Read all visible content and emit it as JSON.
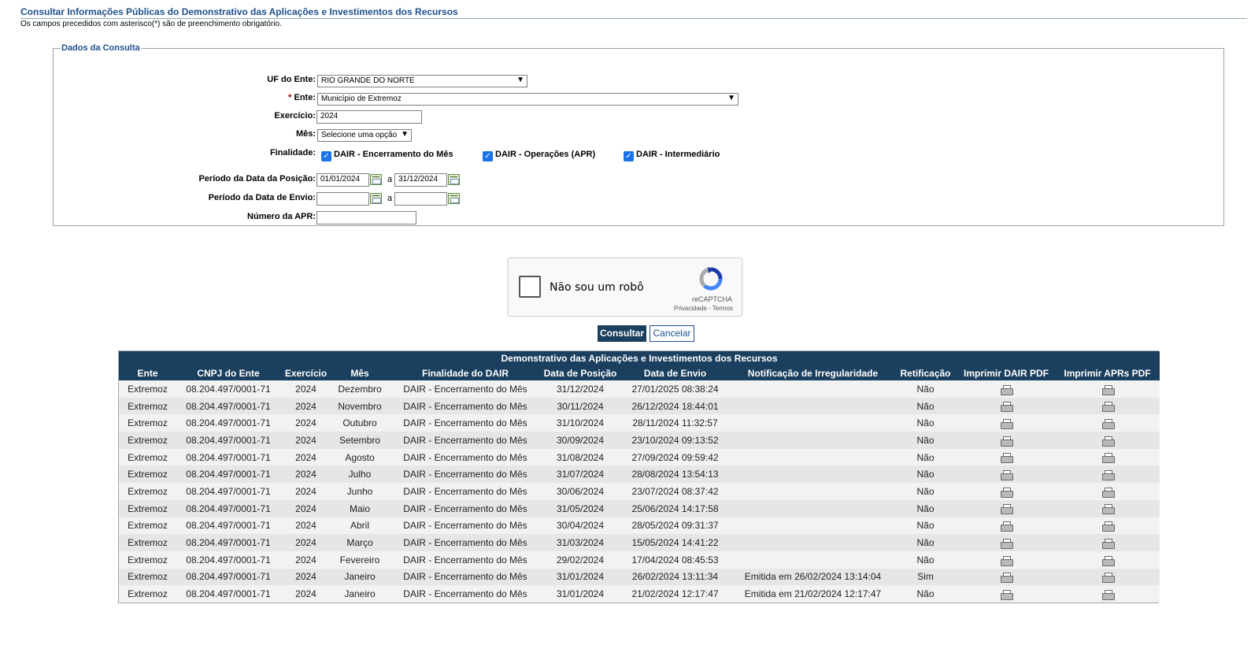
{
  "header": {
    "title": "Consultar Informações Públicas do Demonstrativo das Aplicações e Investimentos dos Recursos",
    "subtitle": "Os campos precedidos com asterisco(*) são de preenchimento obrigatório."
  },
  "form": {
    "legend": "Dados da Consulta",
    "uf_label": "UF do Ente:",
    "uf_value": "RIO GRANDE DO NORTE",
    "ente_required_mark": "*",
    "ente_label": "Ente:",
    "ente_value": "Município de Extremoz",
    "exercicio_label": "Exercício:",
    "exercicio_value": "2024",
    "mes_label": "Mês:",
    "mes_value": "Selecione uma opção",
    "finalidade_label": "Finalidade:",
    "finalidade_options": [
      {
        "label": "DAIR - Encerramento do Mês",
        "checked": true
      },
      {
        "label": "DAIR - Operações (APR)",
        "checked": true
      },
      {
        "label": "DAIR - Intermediário",
        "checked": true
      }
    ],
    "periodo_posicao_label": "Período da Data da Posição:",
    "posicao_inicio": "01/01/2024",
    "posicao_fim": "31/12/2024",
    "periodo_envio_label": "Período da Data de Envio:",
    "envio_inicio": "",
    "envio_fim": "",
    "range_sep": "a",
    "apr_label": "Número da APR:",
    "apr_value": ""
  },
  "captcha": {
    "label": "Não sou um robô",
    "brand": "reCAPTCHA",
    "links": "Privacidade - Termos"
  },
  "buttons": {
    "consultar": "Consultar",
    "cancelar": "Cancelar"
  },
  "table": {
    "caption": "Demonstrativo das Aplicações e Investimentos dos Recursos",
    "headers": [
      "Ente",
      "CNPJ do Ente",
      "Exercício",
      "Mês",
      "Finalidade do DAIR",
      "Data de Posição",
      "Data de Envio",
      "Notificação de Irregularidade",
      "Retificação",
      "Imprimir DAIR PDF",
      "Imprimir APRs PDF"
    ],
    "rows": [
      [
        "Extremoz",
        "08.204.497/0001-71",
        "2024",
        "Dezembro",
        "DAIR - Encerramento do Mês",
        "31/12/2024",
        "27/01/2025 08:38:24",
        "",
        "Não"
      ],
      [
        "Extremoz",
        "08.204.497/0001-71",
        "2024",
        "Novembro",
        "DAIR - Encerramento do Mês",
        "30/11/2024",
        "26/12/2024 18:44:01",
        "",
        "Não"
      ],
      [
        "Extremoz",
        "08.204.497/0001-71",
        "2024",
        "Outubro",
        "DAIR - Encerramento do Mês",
        "31/10/2024",
        "28/11/2024 11:32:57",
        "",
        "Não"
      ],
      [
        "Extremoz",
        "08.204.497/0001-71",
        "2024",
        "Setembro",
        "DAIR - Encerramento do Mês",
        "30/09/2024",
        "23/10/2024 09:13:52",
        "",
        "Não"
      ],
      [
        "Extremoz",
        "08.204.497/0001-71",
        "2024",
        "Agosto",
        "DAIR - Encerramento do Mês",
        "31/08/2024",
        "27/09/2024 09:59:42",
        "",
        "Não"
      ],
      [
        "Extremoz",
        "08.204.497/0001-71",
        "2024",
        "Julho",
        "DAIR - Encerramento do Mês",
        "31/07/2024",
        "28/08/2024 13:54:13",
        "",
        "Não"
      ],
      [
        "Extremoz",
        "08.204.497/0001-71",
        "2024",
        "Junho",
        "DAIR - Encerramento do Mês",
        "30/06/2024",
        "23/07/2024 08:37:42",
        "",
        "Não"
      ],
      [
        "Extremoz",
        "08.204.497/0001-71",
        "2024",
        "Maio",
        "DAIR - Encerramento do Mês",
        "31/05/2024",
        "25/06/2024 14:17:58",
        "",
        "Não"
      ],
      [
        "Extremoz",
        "08.204.497/0001-71",
        "2024",
        "Abril",
        "DAIR - Encerramento do Mês",
        "30/04/2024",
        "28/05/2024 09:31:37",
        "",
        "Não"
      ],
      [
        "Extremoz",
        "08.204.497/0001-71",
        "2024",
        "Março",
        "DAIR - Encerramento do Mês",
        "31/03/2024",
        "15/05/2024 14:41:22",
        "",
        "Não"
      ],
      [
        "Extremoz",
        "08.204.497/0001-71",
        "2024",
        "Fevereiro",
        "DAIR - Encerramento do Mês",
        "29/02/2024",
        "17/04/2024 08:45:53",
        "",
        "Não"
      ],
      [
        "Extremoz",
        "08.204.497/0001-71",
        "2024",
        "Janeiro",
        "DAIR - Encerramento do Mês",
        "31/01/2024",
        "26/02/2024 13:11:34",
        "Emitida em 26/02/2024 13:14:04",
        "Sim"
      ],
      [
        "Extremoz",
        "08.204.497/0001-71",
        "2024",
        "Janeiro",
        "DAIR - Encerramento do Mês",
        "31/01/2024",
        "21/02/2024 12:17:47",
        "Emitida em 21/02/2024 12:17:47",
        "Não"
      ]
    ]
  },
  "colors": {
    "header_bg": "#1b3f5e",
    "title_text": "#1e4f8c",
    "checkbox": "#1a73e8"
  }
}
